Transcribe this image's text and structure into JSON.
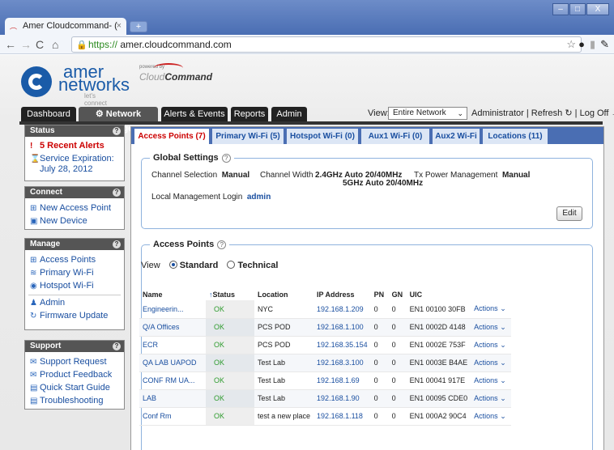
{
  "browser": {
    "tab_title": "Amer Cloudcommand- (",
    "tab_close": "×",
    "new_tab": "+",
    "url_scheme": "https://",
    "url_host": "amer.cloudcommand.com"
  },
  "brand": {
    "logo_word1": "amer",
    "logo_word2": "networks",
    "tagline": "let's connect",
    "powered_by": "powered by",
    "cc_part1": "Cloud",
    "cc_part2": "Command"
  },
  "nav": {
    "tabs": [
      {
        "label": "Dashboard"
      },
      {
        "label": "Network Manager"
      },
      {
        "label": "Alerts & Events"
      },
      {
        "label": "Reports"
      },
      {
        "label": "Admin"
      }
    ],
    "view_label": "View:",
    "view_value": "Entire Network",
    "user": "Administrator",
    "refresh": "Refresh",
    "logoff": "Log Off"
  },
  "sidebar": {
    "status": {
      "title": "Status",
      "alerts": "5 Recent Alerts",
      "service": "Service Expiration:",
      "service_date": "July 28, 2012"
    },
    "connect": {
      "title": "Connect",
      "items": [
        "New Access Point",
        "New Device"
      ]
    },
    "manage": {
      "title": "Manage",
      "items": [
        "Access Points",
        "Primary Wi-Fi",
        "Hotspot Wi-Fi",
        "Admin",
        "Firmware Update"
      ]
    },
    "support": {
      "title": "Support",
      "items": [
        "Support Request",
        "Product Feedback",
        "Quick Start Guide",
        "Troubleshooting"
      ]
    }
  },
  "content": {
    "tabs": [
      {
        "label": "Access Points (7)"
      },
      {
        "label": "Primary Wi-Fi (5)"
      },
      {
        "label": "Hotspot Wi-Fi (0)"
      },
      {
        "label": "Aux1 Wi-Fi (0)"
      },
      {
        "label": "Aux2 Wi-Fi"
      },
      {
        "label": "Locations (11)"
      }
    ],
    "global": {
      "title": "Global Settings",
      "channel_sel_label": "Channel Selection",
      "channel_sel_value": "Manual",
      "channel_width_label": "Channel Width",
      "cw_24": "2.4GHz Auto 20/40MHz",
      "cw_5": "5GHz Auto 20/40MHz",
      "tx_label": "Tx Power Management",
      "tx_value": "Manual",
      "login_label": "Local Management Login",
      "login_value": "admin",
      "edit": "Edit"
    },
    "ap": {
      "title": "Access Points",
      "view_label": "View",
      "view_standard": "Standard",
      "view_technical": "Technical",
      "columns": [
        "Name",
        "Status",
        "Location",
        "IP Address",
        "PN",
        "GN",
        "UIC"
      ],
      "rows": [
        {
          "name": "Engineerin...",
          "status": "OK",
          "location": "NYC",
          "ip": "192.168.1.209",
          "pn": "0",
          "gn": "0",
          "uic": "EN1 00100 30FB",
          "action": "Actions"
        },
        {
          "name": "Q/A Offices",
          "status": "OK",
          "location": "PCS POD",
          "ip": "192.168.1.100",
          "pn": "0",
          "gn": "0",
          "uic": "EN1 0002D 4148",
          "action": "Actions"
        },
        {
          "name": "ECR",
          "status": "OK",
          "location": "PCS POD",
          "ip": "192.168.35.154",
          "pn": "0",
          "gn": "0",
          "uic": "EN1 0002E 753F",
          "action": "Actions"
        },
        {
          "name": "QA LAB UAPOD",
          "status": "OK",
          "location": "Test Lab",
          "ip": "192.168.3.100",
          "pn": "0",
          "gn": "0",
          "uic": "EN1 0003E B4AE",
          "action": "Actions"
        },
        {
          "name": "CONF RM UA...",
          "status": "OK",
          "location": "Test Lab",
          "ip": "192.168.1.69",
          "pn": "0",
          "gn": "0",
          "uic": "EN1 00041 917E",
          "action": "Actions"
        },
        {
          "name": "LAB",
          "status": "OK",
          "location": "Test Lab",
          "ip": "192.168.1.90",
          "pn": "0",
          "gn": "0",
          "uic": "EN1 00095 CDE0",
          "action": "Actions"
        },
        {
          "name": "Conf Rm",
          "status": "OK",
          "location": "test a new place",
          "ip": "192.168.1.118",
          "pn": "0",
          "gn": "0",
          "uic": "EN1 000A2 90C4",
          "action": "Actions"
        }
      ]
    }
  }
}
